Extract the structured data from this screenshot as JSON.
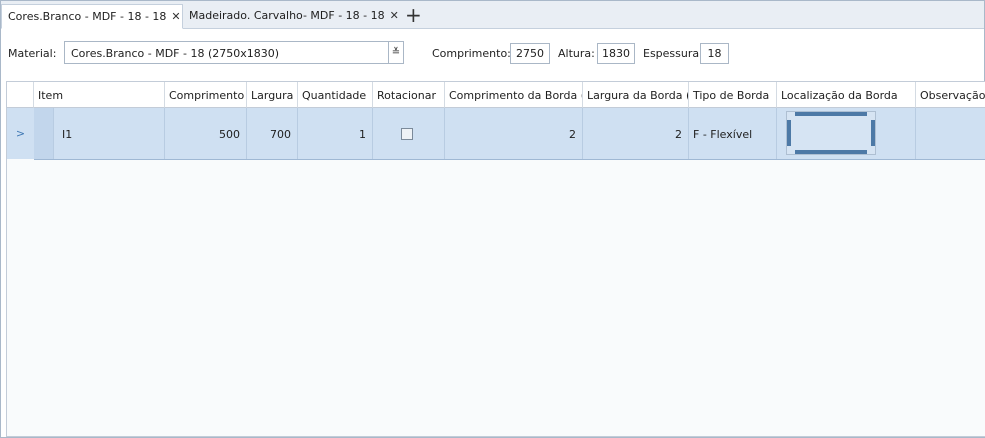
{
  "tabs": [
    {
      "label": "Cores.Branco - MDF - 18 - 18",
      "active": true
    },
    {
      "label": "Madeirado. Carvalho- MDF - 18 - 18",
      "active": false
    }
  ],
  "close_glyph": "✕",
  "add_tab_glyph": "+",
  "material": {
    "label": "Material:",
    "value": "Cores.Branco - MDF - 18 (2750x1830)",
    "dropdown_glyph": "≚"
  },
  "dims": {
    "comprimento_label": "Comprimento:",
    "comprimento": "2750",
    "altura_label": "Altura:",
    "altura": "1830",
    "espessura_label": "Espessura:",
    "espessura": "18"
  },
  "grid": {
    "columns": [
      "Item",
      "Comprimento",
      "Largura",
      "Quantidade",
      "Rotacionar",
      "Comprimento da Borda (",
      "Largura da Borda (",
      "Tipo de Borda",
      "Localização da Borda",
      "Observação"
    ],
    "rows": [
      {
        "indicator": ">",
        "item": "I1",
        "comprimento": "500",
        "largura": "700",
        "quantidade": "1",
        "rotacionar": false,
        "comp_borda": "2",
        "larg_borda": "2",
        "tipo_borda": "F - Flexível",
        "edges": {
          "top": true,
          "bottom": true,
          "left": true,
          "right": true
        },
        "observacao": ""
      }
    ]
  },
  "colors": {
    "edge": "#4d79a6",
    "selected_row": "#cfe0f2"
  }
}
